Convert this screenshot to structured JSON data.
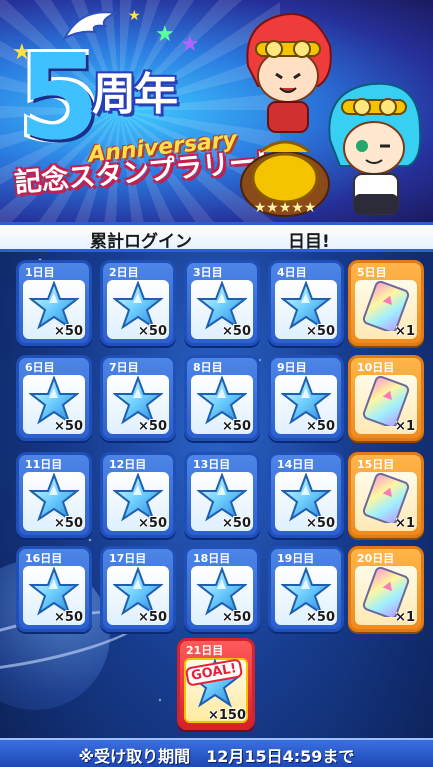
{
  "header": {
    "number": "5",
    "nenen": "周年",
    "anniversary": "Anniversary",
    "event_title": "記念スタンプラリー!"
  },
  "login_bar": {
    "label": "累計ログイン",
    "count": "",
    "unit": "日目!"
  },
  "rewards": [
    {
      "day": "1日目",
      "qty": "×50",
      "item": "star-gem-icon"
    },
    {
      "day": "2日目",
      "qty": "×50",
      "item": "star-gem-icon"
    },
    {
      "day": "3日目",
      "qty": "×50",
      "item": "star-gem-icon"
    },
    {
      "day": "4日目",
      "qty": "×50",
      "item": "star-gem-icon"
    },
    {
      "day": "5日目",
      "qty": "×1",
      "item": "ticket-icon"
    },
    {
      "day": "6日目",
      "qty": "×50",
      "item": "star-gem-icon"
    },
    {
      "day": "7日目",
      "qty": "×50",
      "item": "star-gem-icon"
    },
    {
      "day": "8日目",
      "qty": "×50",
      "item": "star-gem-icon"
    },
    {
      "day": "9日目",
      "qty": "×50",
      "item": "star-gem-icon"
    },
    {
      "day": "10日目",
      "qty": "×1",
      "item": "ticket-icon"
    },
    {
      "day": "11日目",
      "qty": "×50",
      "item": "star-gem-icon"
    },
    {
      "day": "12日目",
      "qty": "×50",
      "item": "star-gem-icon"
    },
    {
      "day": "13日目",
      "qty": "×50",
      "item": "star-gem-icon"
    },
    {
      "day": "14日目",
      "qty": "×50",
      "item": "star-gem-icon"
    },
    {
      "day": "15日目",
      "qty": "×1",
      "item": "ticket-icon"
    },
    {
      "day": "16日目",
      "qty": "×50",
      "item": "star-gem-icon"
    },
    {
      "day": "17日目",
      "qty": "×50",
      "item": "star-gem-icon"
    },
    {
      "day": "18日目",
      "qty": "×50",
      "item": "star-gem-icon"
    },
    {
      "day": "19日目",
      "qty": "×50",
      "item": "star-gem-icon"
    },
    {
      "day": "20日目",
      "qty": "×1",
      "item": "ticket-icon"
    },
    {
      "day": "21日目",
      "qty": "×150",
      "item": "goal-star-gem-icon",
      "badge": "GOAL!"
    }
  ],
  "footer": {
    "text": "※受け取り期間　12月15日4:59まで"
  },
  "colors": {
    "tile_blue": "#2c5fcf",
    "tile_orange": "#f08a1e",
    "tile_red": "#d8202a",
    "footer": "#1d48b6"
  }
}
